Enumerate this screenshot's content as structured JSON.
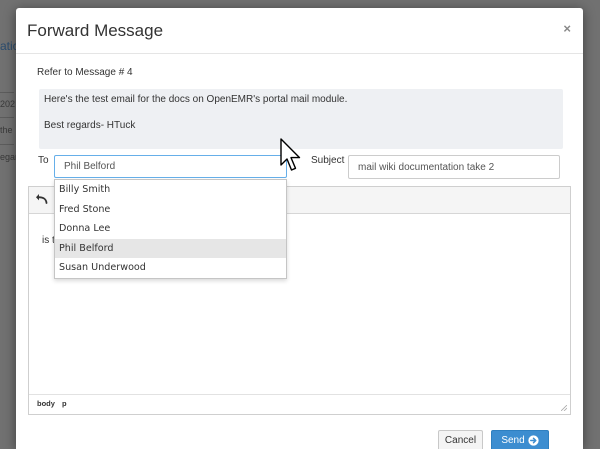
{
  "background": {
    "fragments": [
      "atic",
      "202",
      "the",
      "egar"
    ]
  },
  "dialog": {
    "title": "Forward Message",
    "close_glyph": "×",
    "refer_label": "Refer to Message # 4",
    "quoted_lines": [
      "Here's the test email for the docs on OpenEMR's portal mail module.",
      "Best regards- HTuck"
    ],
    "to_label": "To",
    "to_value": "Phil Belford",
    "subject_label": "Subject",
    "subject_value": "mail wiki documentation take 2",
    "editor": {
      "undo_icon": "undo-icon",
      "body_fragment": "is t",
      "path": [
        "body",
        "p"
      ]
    },
    "recipients": [
      "Billy Smith",
      "Fred Stone",
      "Donna Lee",
      "Phil Belford",
      "Susan Underwood"
    ],
    "highlighted_recipient": "Phil Belford",
    "cancel_label": "Cancel",
    "send_label": "Send",
    "send_icon": "arrow-circle-right-icon"
  },
  "colors": {
    "accent": "#3c8dd0",
    "focus_border": "#66afe9",
    "overlay": "#717171"
  }
}
